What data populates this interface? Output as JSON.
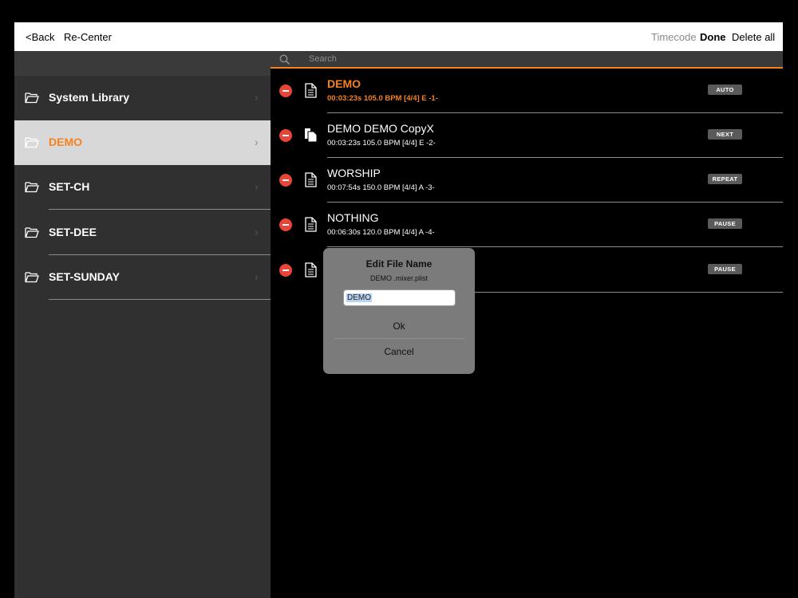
{
  "toolbar": {
    "back_label": "<Back",
    "recenter_label": "Re-Center",
    "timecode_label": "Timecode",
    "done_label": "Done",
    "delete_all_label": "Delete all"
  },
  "search": {
    "placeholder": "Search"
  },
  "sidebar": {
    "items": [
      {
        "label": "System Library",
        "selected": false
      },
      {
        "label": "DEMO",
        "selected": true
      },
      {
        "label": "SET-CH",
        "selected": false
      },
      {
        "label": "SET-DEE",
        "selected": false
      },
      {
        "label": "SET-SUNDAY",
        "selected": false
      }
    ]
  },
  "songs": [
    {
      "title": "DEMO",
      "meta": "00:03:23s  105.0 BPM  [4/4] E  -1-",
      "badge": "AUTO",
      "icon": "document-icon",
      "active": true
    },
    {
      "title": "DEMO DEMO  CopyX",
      "meta": "00:03:23s  105.0 BPM  [4/4] E  -2-",
      "badge": "NEXT",
      "icon": "copy-document-icon",
      "active": false
    },
    {
      "title": "WORSHIP",
      "meta": "00:07:54s  150.0 BPM  [4/4] A  -3-",
      "badge": "REPEAT",
      "icon": "document-icon",
      "active": false
    },
    {
      "title": "NOTHING",
      "meta": "00:06:30s  120.0 BPM  [4/4] A  -4-",
      "badge": "PAUSE",
      "icon": "document-icon",
      "active": false
    },
    {
      "title": "",
      "meta": "",
      "badge": "PAUSE",
      "icon": "document-icon",
      "active": false
    }
  ],
  "dialog": {
    "title": "Edit File Name",
    "message": "DEMO .mixer.plist",
    "input_value": "DEMO",
    "ok_label": "Ok",
    "cancel_label": "Cancel"
  },
  "colors": {
    "accent": "#f5821f",
    "delete": "#e64537",
    "sidebar_bg": "#303030",
    "selected_bg": "#d8d8d8"
  }
}
